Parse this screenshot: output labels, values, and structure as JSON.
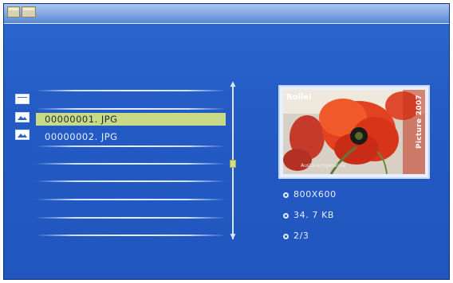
{
  "topbar": {
    "icons": [
      "folder-icon",
      "folders-icon"
    ]
  },
  "file_list": {
    "folder_entry": {
      "icon": "folder-icon",
      "label": ""
    },
    "files": [
      {
        "icon": "image-icon",
        "name": "00000001. JPG",
        "selected": true
      },
      {
        "icon": "image-icon",
        "name": "00000002. JPG",
        "selected": false
      }
    ]
  },
  "scrollbar": {
    "up": "▲",
    "down": "▼"
  },
  "preview": {
    "brand": "Rollei",
    "side_text": "Picture 2007",
    "bottom_text": "Austauschgarantie"
  },
  "info": {
    "resolution": "800X600",
    "size": "34. 7 KB",
    "position": "2/3"
  },
  "colors": {
    "screen_bg": "#245ac4",
    "selection": "#c8da86",
    "text": "#e8f0ff"
  }
}
